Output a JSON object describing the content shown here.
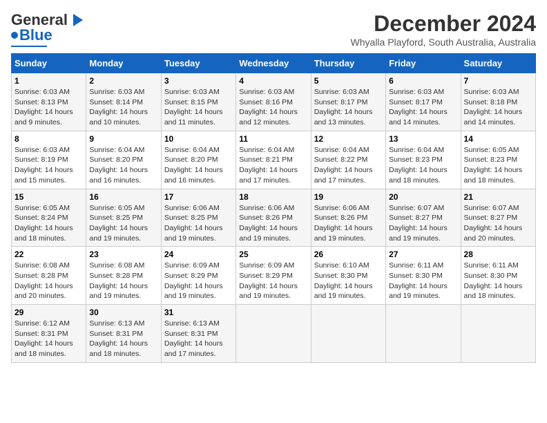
{
  "logo": {
    "line1": "General",
    "line2": "Blue"
  },
  "title": "December 2024",
  "subtitle": "Whyalla Playford, South Australia, Australia",
  "days_of_week": [
    "Sunday",
    "Monday",
    "Tuesday",
    "Wednesday",
    "Thursday",
    "Friday",
    "Saturday"
  ],
  "weeks": [
    [
      {
        "day": "1",
        "sunrise": "6:03 AM",
        "sunset": "8:13 PM",
        "daylight": "14 hours and 9 minutes."
      },
      {
        "day": "2",
        "sunrise": "6:03 AM",
        "sunset": "8:14 PM",
        "daylight": "14 hours and 10 minutes."
      },
      {
        "day": "3",
        "sunrise": "6:03 AM",
        "sunset": "8:15 PM",
        "daylight": "14 hours and 11 minutes."
      },
      {
        "day": "4",
        "sunrise": "6:03 AM",
        "sunset": "8:16 PM",
        "daylight": "14 hours and 12 minutes."
      },
      {
        "day": "5",
        "sunrise": "6:03 AM",
        "sunset": "8:17 PM",
        "daylight": "14 hours and 13 minutes."
      },
      {
        "day": "6",
        "sunrise": "6:03 AM",
        "sunset": "8:17 PM",
        "daylight": "14 hours and 14 minutes."
      },
      {
        "day": "7",
        "sunrise": "6:03 AM",
        "sunset": "8:18 PM",
        "daylight": "14 hours and 14 minutes."
      }
    ],
    [
      {
        "day": "8",
        "sunrise": "6:03 AM",
        "sunset": "8:19 PM",
        "daylight": "14 hours and 15 minutes."
      },
      {
        "day": "9",
        "sunrise": "6:04 AM",
        "sunset": "8:20 PM",
        "daylight": "14 hours and 16 minutes."
      },
      {
        "day": "10",
        "sunrise": "6:04 AM",
        "sunset": "8:20 PM",
        "daylight": "14 hours and 16 minutes."
      },
      {
        "day": "11",
        "sunrise": "6:04 AM",
        "sunset": "8:21 PM",
        "daylight": "14 hours and 17 minutes."
      },
      {
        "day": "12",
        "sunrise": "6:04 AM",
        "sunset": "8:22 PM",
        "daylight": "14 hours and 17 minutes."
      },
      {
        "day": "13",
        "sunrise": "6:04 AM",
        "sunset": "8:23 PM",
        "daylight": "14 hours and 18 minutes."
      },
      {
        "day": "14",
        "sunrise": "6:05 AM",
        "sunset": "8:23 PM",
        "daylight": "14 hours and 18 minutes."
      }
    ],
    [
      {
        "day": "15",
        "sunrise": "6:05 AM",
        "sunset": "8:24 PM",
        "daylight": "14 hours and 18 minutes."
      },
      {
        "day": "16",
        "sunrise": "6:05 AM",
        "sunset": "8:25 PM",
        "daylight": "14 hours and 19 minutes."
      },
      {
        "day": "17",
        "sunrise": "6:06 AM",
        "sunset": "8:25 PM",
        "daylight": "14 hours and 19 minutes."
      },
      {
        "day": "18",
        "sunrise": "6:06 AM",
        "sunset": "8:26 PM",
        "daylight": "14 hours and 19 minutes."
      },
      {
        "day": "19",
        "sunrise": "6:06 AM",
        "sunset": "8:26 PM",
        "daylight": "14 hours and 19 minutes."
      },
      {
        "day": "20",
        "sunrise": "6:07 AM",
        "sunset": "8:27 PM",
        "daylight": "14 hours and 19 minutes."
      },
      {
        "day": "21",
        "sunrise": "6:07 AM",
        "sunset": "8:27 PM",
        "daylight": "14 hours and 20 minutes."
      }
    ],
    [
      {
        "day": "22",
        "sunrise": "6:08 AM",
        "sunset": "8:28 PM",
        "daylight": "14 hours and 20 minutes."
      },
      {
        "day": "23",
        "sunrise": "6:08 AM",
        "sunset": "8:28 PM",
        "daylight": "14 hours and 19 minutes."
      },
      {
        "day": "24",
        "sunrise": "6:09 AM",
        "sunset": "8:29 PM",
        "daylight": "14 hours and 19 minutes."
      },
      {
        "day": "25",
        "sunrise": "6:09 AM",
        "sunset": "8:29 PM",
        "daylight": "14 hours and 19 minutes."
      },
      {
        "day": "26",
        "sunrise": "6:10 AM",
        "sunset": "8:30 PM",
        "daylight": "14 hours and 19 minutes."
      },
      {
        "day": "27",
        "sunrise": "6:11 AM",
        "sunset": "8:30 PM",
        "daylight": "14 hours and 19 minutes."
      },
      {
        "day": "28",
        "sunrise": "6:11 AM",
        "sunset": "8:30 PM",
        "daylight": "14 hours and 18 minutes."
      }
    ],
    [
      {
        "day": "29",
        "sunrise": "6:12 AM",
        "sunset": "8:31 PM",
        "daylight": "14 hours and 18 minutes."
      },
      {
        "day": "30",
        "sunrise": "6:13 AM",
        "sunset": "8:31 PM",
        "daylight": "14 hours and 18 minutes."
      },
      {
        "day": "31",
        "sunrise": "6:13 AM",
        "sunset": "8:31 PM",
        "daylight": "14 hours and 17 minutes."
      },
      null,
      null,
      null,
      null
    ]
  ],
  "labels": {
    "sunrise": "Sunrise:",
    "sunset": "Sunset:",
    "daylight": "Daylight:"
  }
}
